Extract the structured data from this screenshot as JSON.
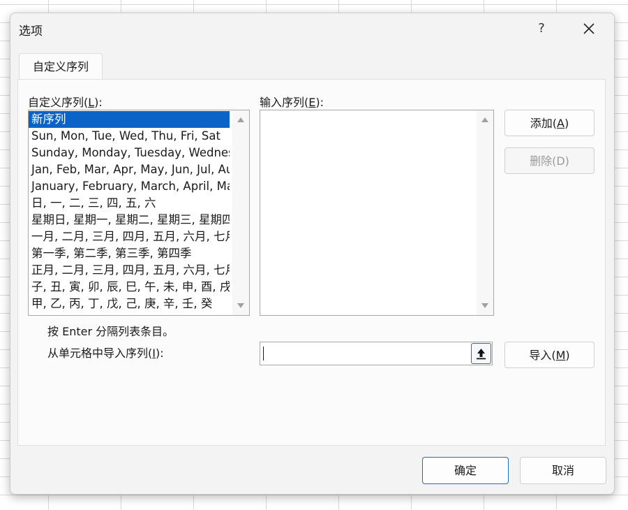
{
  "dialog": {
    "title": "选项",
    "help_label": "?",
    "tab_label": "自定义序列"
  },
  "custom_lists": {
    "label_prefix": "自定义序列(",
    "label_key": "L",
    "label_suffix": "):",
    "selected_index": 0,
    "items": [
      "新序列",
      "Sun, Mon, Tue, Wed, Thu, Fri, Sat",
      "Sunday, Monday, Tuesday, Wednesday, Thursday, Friday, Saturday",
      "Jan, Feb, Mar, Apr, May, Jun, Jul, Aug, Sep, Oct, Nov, Dec",
      "January, February, March, April, May, June, July, August, September, October, November, December",
      "日, 一, 二, 三, 四, 五, 六",
      "星期日, 星期一, 星期二, 星期三, 星期四, 星期五, 星期六",
      "一月, 二月, 三月, 四月, 五月, 六月, 七月, 八月, 九月, 十月, 十一月, 十二月",
      "第一季, 第二季, 第三季, 第四季",
      "正月, 二月, 三月, 四月, 五月, 六月, 七月, 八月, 九月, 十月, 十一月, 腊月",
      "子, 丑, 寅, 卯, 辰, 巳, 午, 未, 申, 酉, 戌, 亥",
      "甲, 乙, 丙, 丁, 戊, 己, 庚, 辛, 壬, 癸"
    ]
  },
  "entries": {
    "label_prefix": "输入序列(",
    "label_key": "E",
    "label_suffix": "):",
    "value": ""
  },
  "buttons": {
    "add": {
      "label_prefix": "添加(",
      "label_key": "A",
      "label_suffix": ")"
    },
    "delete_label": "删除(D)",
    "import": {
      "label_prefix": "导入(",
      "label_key": "M",
      "label_suffix": ")"
    },
    "ok_label": "确定",
    "cancel_label": "取消"
  },
  "hint_text": "按 Enter 分隔列表条目。",
  "import_row": {
    "label_prefix": "从单元格中导入序列(",
    "label_key": "I",
    "label_suffix": "):",
    "value": ""
  },
  "icons": {
    "close": "close-icon",
    "collapse": "collapse-dialog-icon",
    "scroll_up": "arrow-up-icon",
    "scroll_down": "arrow-down-icon"
  },
  "colors": {
    "selection": "#0a64c8",
    "accent_border": "#1f6fbf"
  }
}
